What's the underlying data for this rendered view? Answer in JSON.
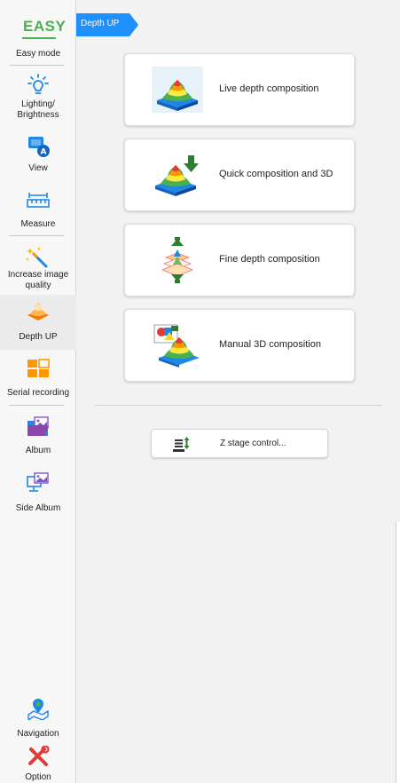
{
  "sidebar": {
    "easy": {
      "logo_text": "EASY",
      "label": "Easy mode"
    },
    "items": [
      {
        "id": "lighting",
        "label": "Lighting/\nBrightness",
        "icon": "lightbulb-icon"
      },
      {
        "id": "view",
        "label": "View",
        "icon": "view-icon"
      },
      {
        "id": "measure",
        "label": "Measure",
        "icon": "ruler-icon"
      },
      {
        "id": "increase",
        "label": "Increase image\nquality",
        "icon": "magic-wand-icon"
      },
      {
        "id": "depth",
        "label": "Depth UP",
        "icon": "depth-up-icon",
        "active": true
      },
      {
        "id": "serial",
        "label": "Serial recording",
        "icon": "grid-icon"
      },
      {
        "id": "album",
        "label": "Album",
        "icon": "album-folder-icon"
      },
      {
        "id": "side_album",
        "label": "Side Album",
        "icon": "monitor-image-icon"
      },
      {
        "id": "navigation",
        "label": "Navigation",
        "icon": "map-pin-icon"
      },
      {
        "id": "option",
        "label": "Option",
        "icon": "tools-icon"
      }
    ]
  },
  "header": {
    "tab_label": "Depth UP"
  },
  "cards": [
    {
      "label": "Live depth composition",
      "icon": "live-depth-icon"
    },
    {
      "label": "Quick composition and 3D",
      "icon": "quick-composition-icon"
    },
    {
      "label": "Fine depth composition",
      "icon": "fine-depth-icon"
    },
    {
      "label": "Manual 3D composition",
      "icon": "manual-3d-icon"
    }
  ],
  "z_stage": {
    "label": "Z stage control...",
    "icon": "z-stage-icon"
  },
  "colors": {
    "accent": "#1e90ff",
    "easy_green": "#4caf50",
    "icon_blue": "#1e88e5",
    "active_bg": "#ebebeb"
  }
}
